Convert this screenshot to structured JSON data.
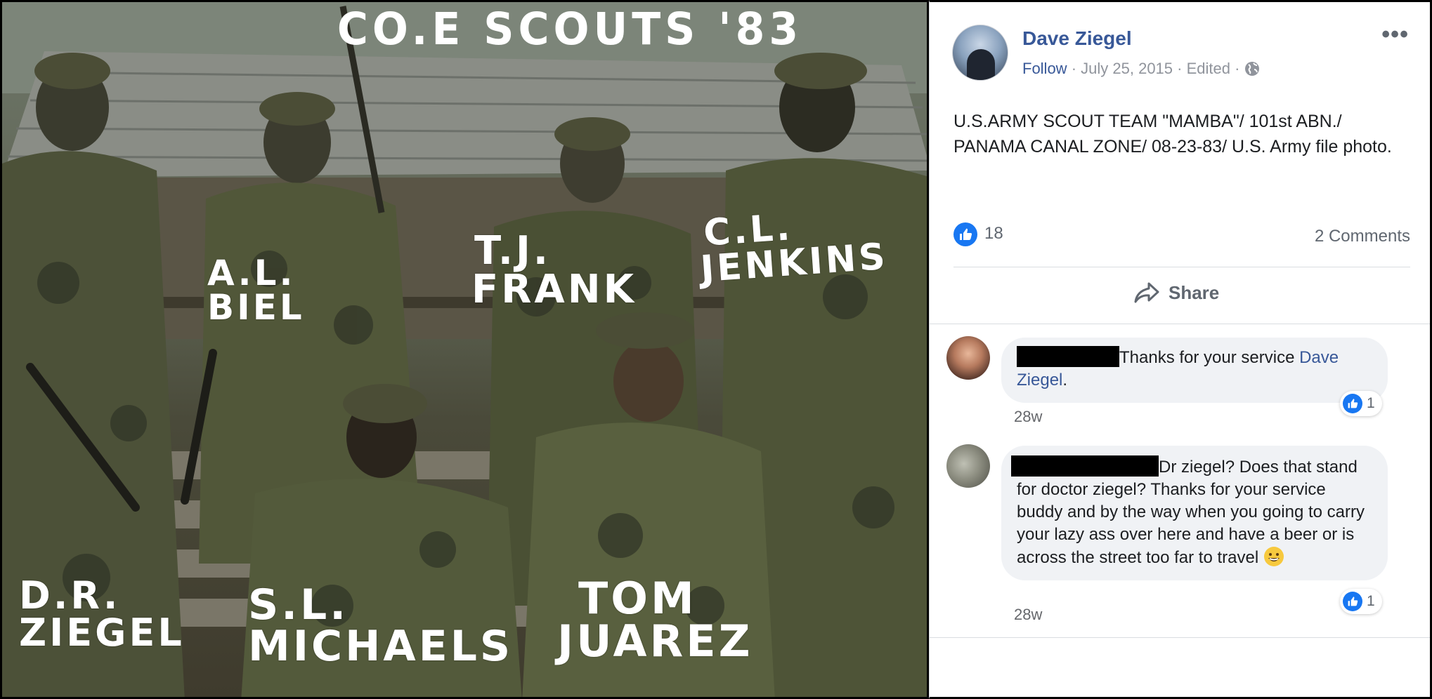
{
  "photo": {
    "caption": "CO.E SCOUTS '83",
    "labels": {
      "biel": [
        "A.L.",
        "BIEL"
      ],
      "frank": [
        "T.J.",
        "FRANK"
      ],
      "jenkins": [
        "C.L.",
        "JENKINS"
      ],
      "ziegel": [
        "D.R.",
        "ZIEGEL"
      ],
      "michaels": [
        "S.L.",
        "MICHAELS"
      ],
      "juarez": [
        "TOM",
        "JUAREZ"
      ]
    }
  },
  "post": {
    "author": "Dave Ziegel",
    "follow_label": "Follow",
    "separator": "·",
    "date": "July 25, 2015",
    "edited_label": "Edited",
    "more_label": "•••",
    "globe_icon": "globe-icon",
    "text": "U.S.ARMY SCOUT TEAM \"MAMBA\"/ 101st ABN./ PANAMA CANAL ZONE/ 08-23-83/ U.S. Army file photo.",
    "like_count": "18",
    "comments_label": "2 Comments",
    "share_label": "Share"
  },
  "comments": [
    {
      "text_before_link": "Thanks for your service ",
      "link_text": "Dave Ziegel",
      "text_after_link": ".",
      "reaction_count": "1",
      "time": "28w"
    },
    {
      "text": "Dr ziegel? Does that stand for doctor ziegel? Thanks for your service buddy and by the way when you going to carry your lazy ass over here and have a beer or is across the street too far to travel",
      "emoji": "grinning-face",
      "reaction_count": "1",
      "time": "28w"
    }
  ],
  "colors": {
    "link": "#385898",
    "like_blue": "#1877f2",
    "meta_gray": "#90949c",
    "bubble_bg": "#f0f2f5"
  }
}
